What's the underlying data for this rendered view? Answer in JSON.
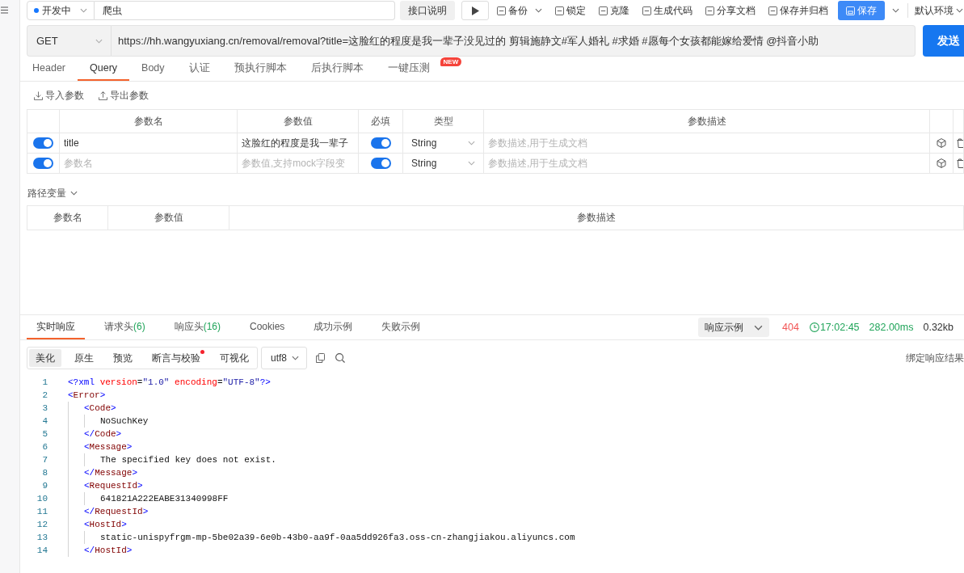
{
  "top_bar": {
    "status": "开发中",
    "name": "爬虫",
    "doc_button": "接口说明",
    "actions": [
      {
        "label": "备份",
        "dropdown": true
      },
      {
        "label": "锁定",
        "dropdown": false
      },
      {
        "label": "克隆",
        "dropdown": false
      },
      {
        "label": "生成代码",
        "dropdown": false
      },
      {
        "label": "分享文档",
        "dropdown": false
      },
      {
        "label": "保存并归档",
        "dropdown": false
      }
    ],
    "save_button": "保存",
    "environment": "默认环境"
  },
  "request": {
    "method": "GET",
    "url": "https://hh.wangyuxiang.cn/removal/removal?title=这脸红的程度是我一辈子没见过的 剪辑施静文#军人婚礼 #求婚 #愿每个女孩都能嫁给爱情 @抖音小助",
    "send_button": "发送"
  },
  "request_tabs": [
    {
      "label": "Header",
      "selected": false
    },
    {
      "label": "Query",
      "selected": true
    },
    {
      "label": "Body",
      "selected": false
    },
    {
      "label": "认证",
      "selected": false
    },
    {
      "label": "预执行脚本",
      "selected": false
    },
    {
      "label": "后执行脚本",
      "selected": false
    },
    {
      "label": "一键压测",
      "selected": false,
      "badge": "NEW"
    }
  ],
  "param_actions": [
    {
      "label": "导入参数",
      "kind": "import"
    },
    {
      "label": "导出参数",
      "kind": "export"
    }
  ],
  "query_table": {
    "columns": [
      "参数名",
      "参数值",
      "必填",
      "类型",
      "参数描述"
    ],
    "rows": [
      {
        "enabled": true,
        "name": {
          "value": "title"
        },
        "value": {
          "value": "这脸红的程度是我一辈子"
        },
        "required": true,
        "type": "String",
        "description": {
          "placeholder": "参数描述,用于生成文档"
        }
      },
      {
        "enabled": true,
        "name": {
          "placeholder": "参数名"
        },
        "value": {
          "placeholder": "参数值,支持mock字段变"
        },
        "required": true,
        "type": "String",
        "description": {
          "placeholder": "参数描述,用于生成文档"
        }
      }
    ]
  },
  "path_variables": {
    "label": "路径变量",
    "expanded": true,
    "columns": [
      "参数名",
      "参数值",
      "参数描述"
    ]
  },
  "response": {
    "tabs": [
      {
        "label": "实时响应",
        "selected": true
      },
      {
        "label": "请求头",
        "count": "(6)",
        "selected": false
      },
      {
        "label": "响应头",
        "count": "(16)",
        "selected": false
      },
      {
        "label": "Cookies",
        "selected": false
      },
      {
        "label": "成功示例",
        "selected": false
      },
      {
        "label": "失败示例",
        "selected": false
      }
    ],
    "example_select": "响应示例",
    "status_code": "404",
    "time": "17:02:45",
    "duration": "282.00ms",
    "size": "0.32kb",
    "view_modes": [
      {
        "label": "美化",
        "selected": true,
        "notice": false
      },
      {
        "label": "原生",
        "selected": false,
        "notice": false
      },
      {
        "label": "预览",
        "selected": false,
        "notice": false
      },
      {
        "label": "断言与校验",
        "selected": false,
        "notice": true
      },
      {
        "label": "可视化",
        "selected": false,
        "notice": false
      }
    ],
    "encoding": "utf8",
    "bind_button": "绑定响应结果",
    "code": {
      "lines": [
        {
          "number": "1",
          "text": "<?xml version=\"1.0\" encoding=\"UTF-8\"?>"
        },
        {
          "number": "2",
          "text": "<Error>",
          "children": [
            {
              "number": "3",
              "text": "<Code>",
              "children": [
                {
                  "number": "4",
                  "text": "NoSuchKey"
                }
              ]
            },
            {
              "number": "5",
              "text": "</Code>"
            },
            {
              "number": "6",
              "text": "<Message>",
              "children": [
                {
                  "number": "7",
                  "text": "The specified key does not exist."
                }
              ]
            },
            {
              "number": "8",
              "text": "</Message>"
            },
            {
              "number": "9",
              "text": "<RequestId>",
              "children": [
                {
                  "number": "10",
                  "text": "641821A222EABE31340998FF"
                }
              ]
            },
            {
              "number": "11",
              "text": "</RequestId>"
            },
            {
              "number": "12",
              "text": "<HostId>",
              "children": [
                {
                  "number": "13",
                  "text": "static-unispyfrgm-mp-5be02a39-6e0b-43b0-aa9f-0aa5dd926fa3.oss-cn-zhangjiakou.aliyuncs.com"
                }
              ]
            },
            {
              "number": "14",
              "text": "</HostId>"
            }
          ]
        }
      ]
    }
  }
}
